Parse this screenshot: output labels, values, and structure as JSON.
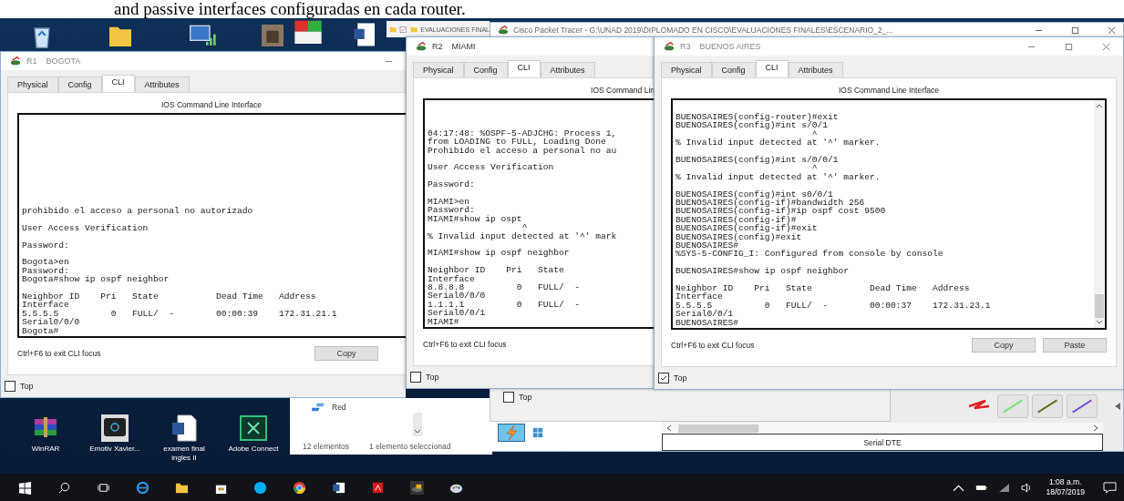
{
  "document_text": "and passive interfaces configuradas en cada router.",
  "explorer_top": {
    "title": "EVALUACIONES FINAL"
  },
  "packet_tracer": {
    "title": "Cisco Packet Tracer - G:\\UNAD 2019\\DIPLOMADO EN CISCO\\EVALUACIONES FINALES\\ESCENARIO_2_...",
    "cable_label": "Serial DTE"
  },
  "back_window": {
    "top_checkbox": {
      "label": "Top",
      "checked": false
    }
  },
  "explorer": {
    "item": "Red",
    "item_count": "12 elementos",
    "selection": "1 elemento seleccionad"
  },
  "routers": [
    {
      "code": "R1",
      "name": "BOGOTA",
      "window_controls": {
        "minimize": true
      },
      "tabs": [
        {
          "label": "Physical",
          "selected": false
        },
        {
          "label": "Config",
          "selected": false
        },
        {
          "label": "CLI",
          "selected": true
        },
        {
          "label": "Attributes",
          "selected": false
        }
      ],
      "header": "IOS Command Line Interface",
      "cli": [
        [
          "prohibido el acceso a personal no autorizado"
        ],
        [
          "User Access Verification"
        ],
        [
          "Password:"
        ],
        [
          "Bogota>en",
          "Password:",
          "Bogota#show ip ospf neighbor"
        ],
        [
          "Neighbor ID    Pri   State           Dead Time   Address",
          "Interface",
          "5.5.5.5          0   FULL/  -        00:00:39    172.31.21.1",
          "Serial0/0/0",
          "Bogota#"
        ]
      ],
      "scrollbar": false,
      "focus_hint": "Ctrl+F6 to exit CLI focus",
      "buttons": [
        "Copy"
      ],
      "top_checkbox": {
        "label": "Top",
        "checked": false
      }
    },
    {
      "code": "R2",
      "name": "MIAMI",
      "tabs": [
        {
          "label": "Physical",
          "selected": false
        },
        {
          "label": "Config",
          "selected": false
        },
        {
          "label": "CLI",
          "selected": true
        },
        {
          "label": "Attributes",
          "selected": false
        }
      ],
      "header": "IOS Command Lin",
      "cli": [
        [
          "04:17:48: %OSPF-5-ADJCHG: Process 1,",
          "from LOADING to FULL, Loading Done",
          "Prohibido el acceso a personal no au"
        ],
        [
          "User Access Verification"
        ],
        [
          "Password:"
        ],
        [
          "MIAMI>en",
          "Password:",
          "MIAMI#show ip ospt",
          "                  ^",
          "% Invalid input detected at '^' mark"
        ],
        [
          "MIAMI#show ip ospf neighbor"
        ],
        [
          "Neighbor ID    Pri   State",
          "Interface",
          "8.8.8.8          0   FULL/  -",
          "Serial0/0/0",
          "1.1.1.1          0   FULL/  -",
          "Serial0/0/1",
          "MIAMI#"
        ]
      ],
      "scrollbar": false,
      "focus_hint": "Ctrl+F6 to exit CLI focus",
      "top_checkbox": {
        "label": "Top",
        "checked": false
      }
    },
    {
      "code": "R3",
      "name": "BUENOS AIRES",
      "window_controls": {
        "minimize": true,
        "maximize": true,
        "close": true
      },
      "tabs": [
        {
          "label": "Physical",
          "selected": false
        },
        {
          "label": "Config",
          "selected": false
        },
        {
          "label": "CLI",
          "selected": true
        },
        {
          "label": "Attributes",
          "selected": false
        }
      ],
      "header": "IOS Command Line Interface",
      "cli": [
        [
          "BUENOSAIRES(config-router)#exit",
          "BUENOSAIRES(config)#int s/0/1",
          "                          ^",
          "% Invalid input detected at '^' marker."
        ],
        [
          "BUENOSAIRES(config)#int s/0/0/1",
          "                          ^",
          "% Invalid input detected at '^' marker."
        ],
        [
          "BUENOSAIRES(config)#int s0/0/1",
          "BUENOSAIRES(config-if)#bandwidth 256",
          "BUENOSAIRES(config-if)#ip ospf cost 9500",
          "BUENOSAIRES(config-if)#",
          "BUENOSAIRES(config-if)#exit",
          "BUENOSAIRES(config)#exit",
          "BUENOSAIRES#",
          "%SYS-5-CONFIG_I: Configured from console by console"
        ],
        [
          "BUENOSAIRES#show ip ospf neighbor"
        ],
        [
          "Neighbor ID    Pri   State           Dead Time   Address",
          "Interface",
          "5.5.5.5          0   FULL/  -        00:00:37    172.31.23.1",
          "Serial0/0/1",
          "BUENOSAIRES#"
        ]
      ],
      "scrollbar": true,
      "focus_hint": "Ctrl+F6 to exit CLI focus",
      "buttons": [
        "Copy",
        "Paste"
      ],
      "top_checkbox": {
        "label": "Top",
        "checked": true
      }
    }
  ],
  "desktop_icons": [
    {
      "label": "WinRAR"
    },
    {
      "label": "Emotiv Xavier..."
    },
    {
      "label": "examen final ingles II"
    },
    {
      "label": "Adobe Connect"
    }
  ],
  "tray": {
    "time": "1:08 a.m.",
    "date": "18/07/2019"
  }
}
